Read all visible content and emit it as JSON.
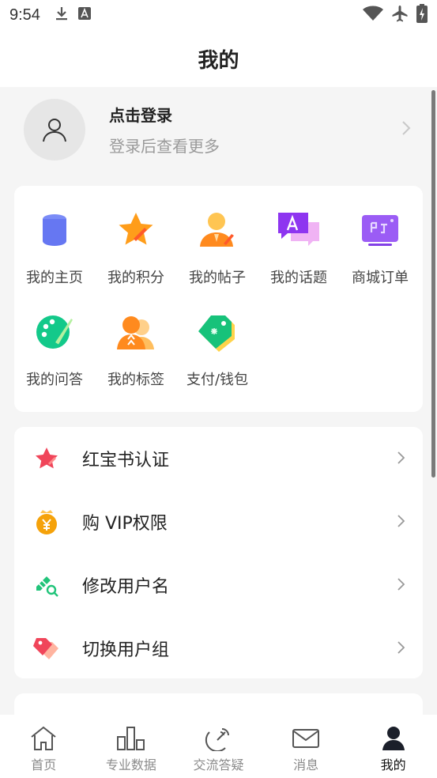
{
  "status": {
    "time": "9:54"
  },
  "header": {
    "title": "我的"
  },
  "profile": {
    "login": "点击登录",
    "subtitle": "登录后查看更多"
  },
  "grid": {
    "items": [
      {
        "label": "我的主页",
        "icon": "home-page-icon"
      },
      {
        "label": "我的积分",
        "icon": "points-star-icon"
      },
      {
        "label": "我的帖子",
        "icon": "post-person-icon"
      },
      {
        "label": "我的话题",
        "icon": "topic-chat-icon"
      },
      {
        "label": "商城订单",
        "icon": "shop-order-icon"
      },
      {
        "label": "我的问答",
        "icon": "qa-palette-icon"
      },
      {
        "label": "我的标签",
        "icon": "tags-people-icon"
      },
      {
        "label": "支付/钱包",
        "icon": "wallet-tag-icon"
      }
    ]
  },
  "menu": {
    "items": [
      {
        "label": "红宝书认证",
        "icon": "star-icon",
        "color": "#f0455a"
      },
      {
        "label": "购 VIP权限",
        "icon": "coin-bag-icon",
        "color": "#f5a20a"
      },
      {
        "label": "修改用户名",
        "icon": "edit-search-icon",
        "color": "#21c47a"
      },
      {
        "label": "切换用户组",
        "icon": "tag-switch-icon",
        "color": "#f0455a"
      }
    ]
  },
  "tabs": [
    {
      "label": "首页",
      "icon": "home-icon",
      "active": false
    },
    {
      "label": "专业数据",
      "icon": "bar-chart-icon",
      "active": false
    },
    {
      "label": "交流答疑",
      "icon": "satellite-icon",
      "active": false
    },
    {
      "label": "消息",
      "icon": "mail-icon",
      "active": false
    },
    {
      "label": "我的",
      "icon": "user-icon",
      "active": true
    }
  ]
}
